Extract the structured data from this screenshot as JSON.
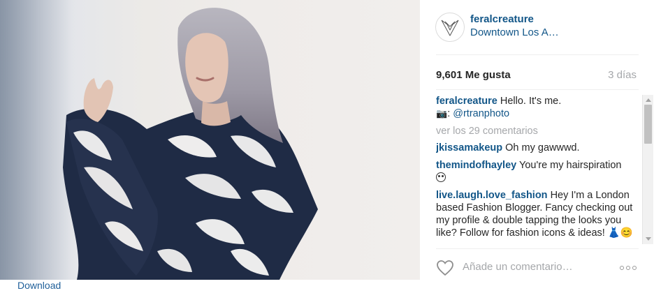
{
  "post": {
    "username": "feralcreature",
    "location": "Downtown Los A…",
    "likes": "9,601 Me gusta",
    "time": "3 días"
  },
  "caption": {
    "user": "feralcreature",
    "text": "Hello. It's me.",
    "credit_prefix": ":",
    "credit_mention": "@rtranphoto"
  },
  "view_all": "ver los 29 comentarios",
  "comments": [
    {
      "user": "jkissamakeup",
      "text": "Oh my gawwwd."
    },
    {
      "user": "themindofhayley",
      "text": "You're my hairspiration"
    },
    {
      "user": "live.laugh.love_fashion",
      "text": "Hey I'm a London based Fashion Blogger. Fancy checking out my profile & double tapping the looks you like? Follow for fashion icons & ideas! 👗😊"
    }
  ],
  "comment_box": {
    "placeholder": "Añade un comentario…"
  },
  "download": {
    "label": "Download"
  },
  "icons": {
    "avatar": "wolf-logo-icon",
    "like": "heart-icon",
    "options": "more-options-icon",
    "caption": "camera-icon"
  },
  "colors": {
    "link": "#125688",
    "muted": "#a5a7aa",
    "text": "#262626",
    "download": "#1f5f99"
  }
}
